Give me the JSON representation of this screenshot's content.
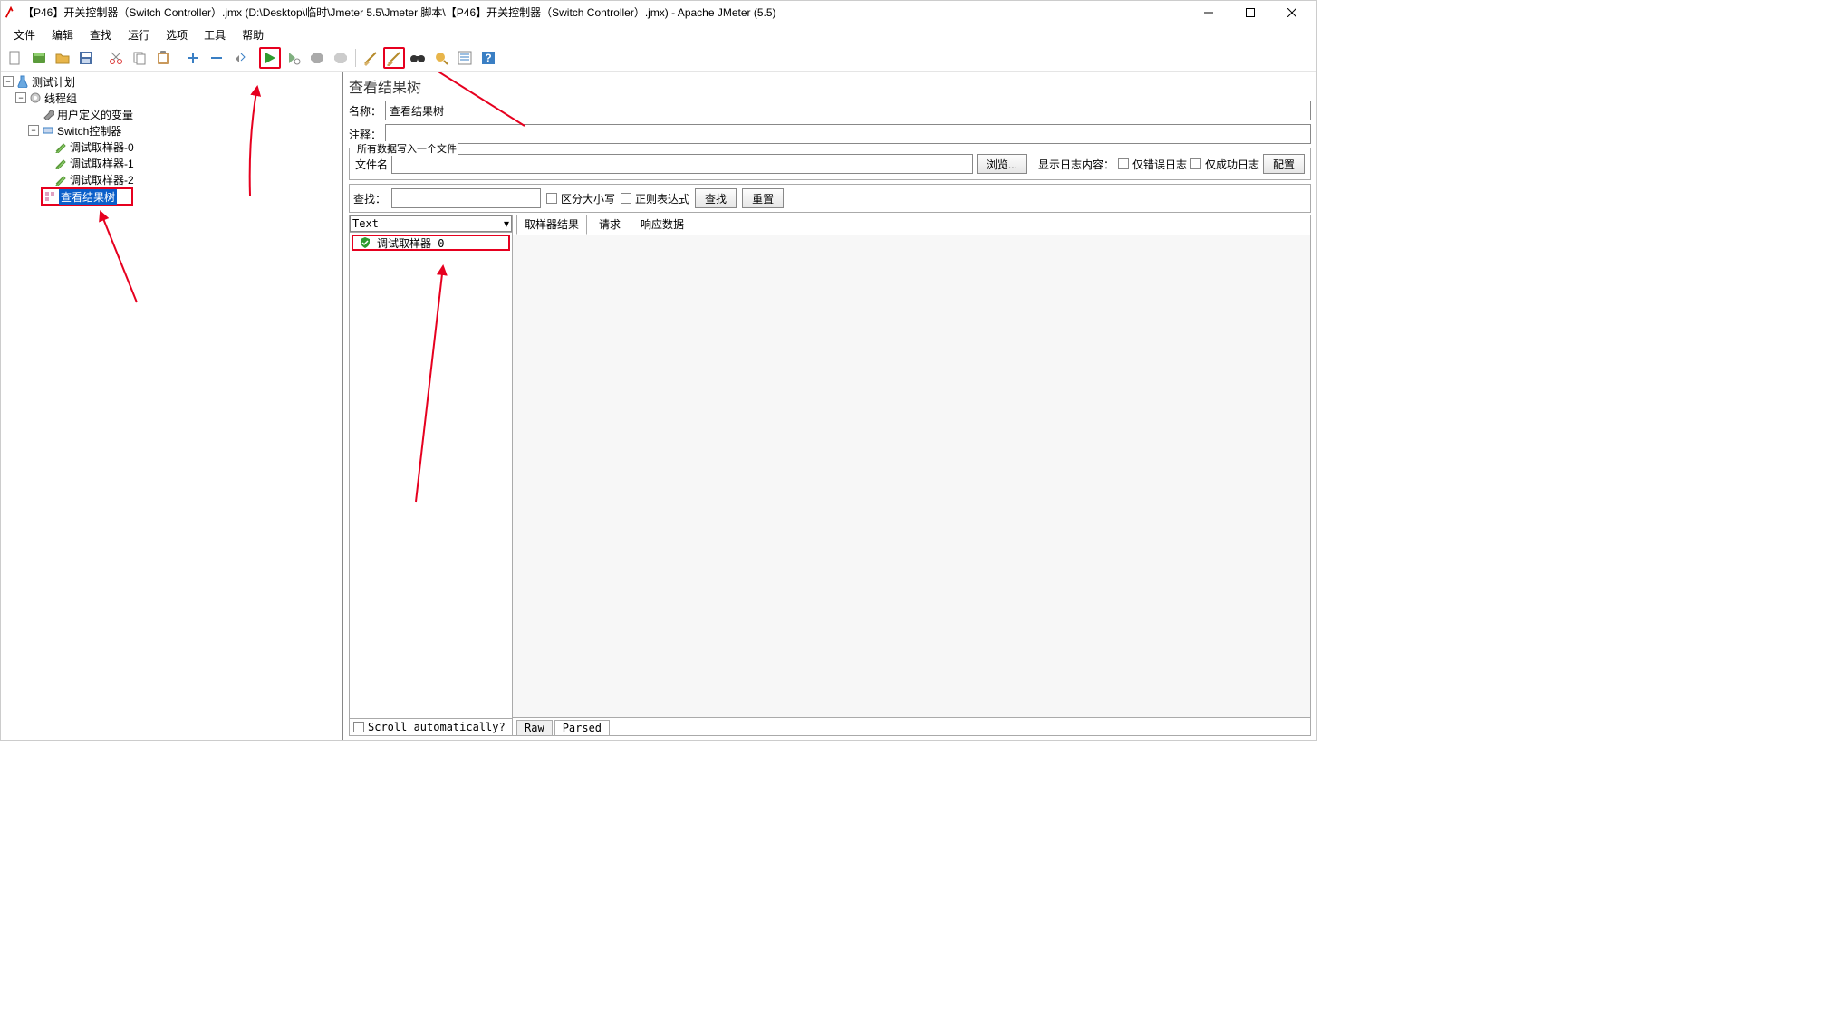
{
  "window": {
    "title": "【P46】开关控制器（Switch Controller）.jmx (D:\\Desktop\\临时\\Jmeter 5.5\\Jmeter 脚本\\【P46】开关控制器（Switch Controller）.jmx) - Apache JMeter (5.5)"
  },
  "menubar": [
    "文件",
    "编辑",
    "查找",
    "运行",
    "选项",
    "工具",
    "帮助"
  ],
  "toolbar_icons": {
    "new": "new-file-icon",
    "templates": "templates-icon",
    "open": "open-folder-icon",
    "save": "save-icon",
    "cut": "cut-icon",
    "copy": "copy-icon",
    "paste": "paste-icon",
    "expand": "plus-icon",
    "collapse": "minus-icon",
    "toggle": "toggle-icon",
    "start": "play-icon",
    "start_no_pauses": "play-nowait-icon",
    "stop": "stop-icon",
    "shutdown": "shutdown-icon",
    "clear": "broom-icon",
    "clear_all": "broom-all-icon",
    "search": "binoculars-icon",
    "reset_search": "reset-search-icon",
    "function_helper": "function-helper-icon",
    "help": "help-icon"
  },
  "tree": {
    "root": {
      "label": "测试计划",
      "icon": "flask-icon"
    },
    "thread_group": {
      "label": "线程组",
      "icon": "gear-icon"
    },
    "user_vars": {
      "label": "用户定义的变量",
      "icon": "wrench-icon"
    },
    "switch_controller": {
      "label": "Switch控制器",
      "icon": "sampler-icon"
    },
    "sampler0": {
      "label": "调试取样器-0",
      "icon": "sampler-request-icon"
    },
    "sampler1": {
      "label": "调试取样器-1",
      "icon": "sampler-request-icon"
    },
    "sampler2": {
      "label": "调试取样器-2",
      "icon": "sampler-request-icon"
    },
    "view_results": {
      "label": "查看结果树",
      "icon": "results-tree-icon"
    }
  },
  "right_panel": {
    "title": "查看结果树",
    "name_label": "名称：",
    "name_value": "查看结果树",
    "comments_label": "注释：",
    "comments_value": "",
    "file_fieldset_legend": "所有数据写入一个文件",
    "filename_label": "文件名",
    "filename_value": "",
    "browse_btn": "浏览...",
    "log_display_label": "显示日志内容：",
    "only_errors": "仅错误日志",
    "only_success": "仅成功日志",
    "configure_btn": "配置",
    "search_label": "查找：",
    "search_value": "",
    "case_sensitive": "区分大小写",
    "regex": "正则表达式",
    "search_btn": "查找",
    "reset_btn": "重置",
    "renderer": "Text",
    "scroll_auto": "Scroll automatically?",
    "result_items": [
      {
        "label": "调试取样器-0",
        "status": "ok"
      }
    ],
    "tabs": {
      "sampler_result": "取样器结果",
      "request": "请求",
      "response": "响应数据"
    },
    "bottom_tabs": {
      "raw": "Raw",
      "parsed": "Parsed"
    }
  }
}
